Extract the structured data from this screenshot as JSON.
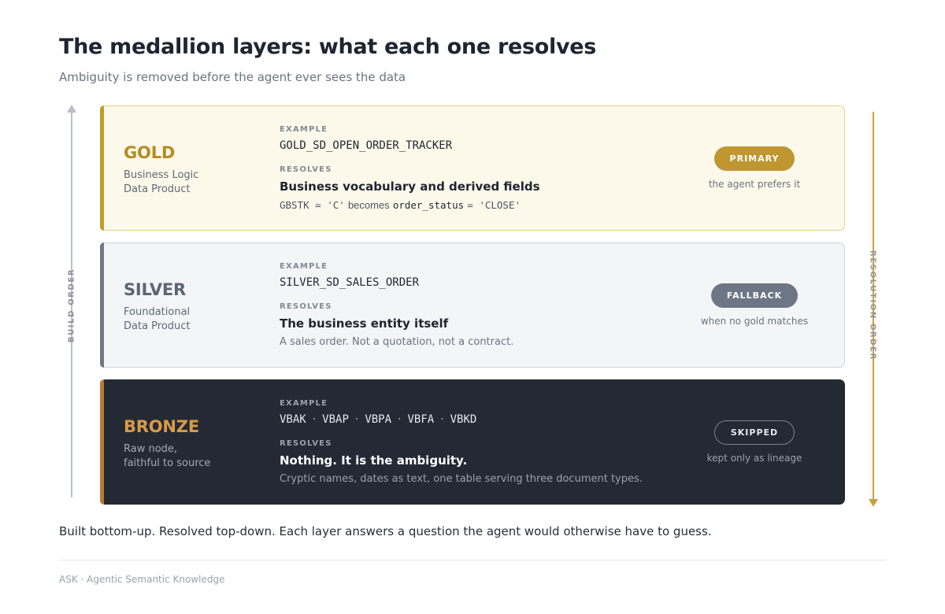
{
  "title": "The medallion layers: what each one resolves",
  "subtitle": "Ambiguity is removed before the agent ever sees the data",
  "axis_left_label": "BUILD ORDER",
  "axis_right_label": "RESOLUTION ORDER",
  "example_caption": "EXAMPLE",
  "resolves_caption": "RESOLVES",
  "colors": {
    "gold": "#c39a2b",
    "silver": "#6f7986",
    "bronze": "#b77b36",
    "bronze_card_bg": "#232a34"
  },
  "layers": {
    "gold": {
      "name": "GOLD",
      "desc_line1": "Business Logic",
      "desc_line2": "Data Product",
      "example": "GOLD_SD_OPEN_ORDER_TRACKER",
      "resolves_title": "Business vocabulary and derived fields",
      "detail_code1": "GBSTK = 'C'",
      "detail_word": "becomes",
      "detail_code2a": "order_status",
      "detail_code2b": "= 'CLOSE'",
      "badge": "PRIMARY",
      "badge_note": "the agent prefers it"
    },
    "silver": {
      "name": "SILVER",
      "desc_line1": "Foundational",
      "desc_line2": "Data Product",
      "example": "SILVER_SD_SALES_ORDER",
      "resolves_title": "The business entity itself",
      "detail": "A sales order. Not a quotation, not a contract.",
      "badge": "FALLBACK",
      "badge_note": "when no gold matches"
    },
    "bronze": {
      "name": "BRONZE",
      "desc_line1": "Raw node,",
      "desc_line2": "faithful to source",
      "tables": [
        "VBAK",
        "VBAP",
        "VBPA",
        "VBFA",
        "VBKD"
      ],
      "separator": "·",
      "resolves_title": "Nothing. It is the ambiguity.",
      "detail": "Cryptic names, dates as text, one table serving three document types.",
      "badge": "SKIPPED",
      "badge_note": "kept only as lineage"
    }
  },
  "footer_text": "Built bottom-up. Resolved top-down. Each layer answers a question the agent would otherwise have to guess.",
  "credit": "ASK · Agentic Semantic Knowledge"
}
